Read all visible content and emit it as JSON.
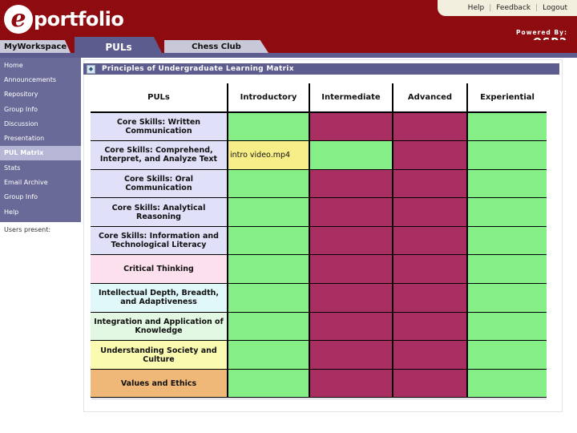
{
  "brand": {
    "logo_letter": "e",
    "logo_text": "portfolio",
    "powered_by": "Powered By:",
    "product": "OSP2",
    "header_color": "#8e0c10",
    "accent_color": "#5c5c8e"
  },
  "top_links": {
    "help": "Help",
    "feedback": "Feedback",
    "logout": "Logout"
  },
  "tabs": {
    "myworkspace": "MyWorkspace",
    "puls": "PULs",
    "chessclub": "Chess Club",
    "active": "PULs"
  },
  "sidebar": {
    "items": [
      {
        "label": "Home"
      },
      {
        "label": "Announcements"
      },
      {
        "label": "Repository"
      },
      {
        "label": "Group Info"
      },
      {
        "label": "Discussion"
      },
      {
        "label": "Presentation"
      },
      {
        "label": "PUL Matrix",
        "active": true
      },
      {
        "label": "Stats"
      },
      {
        "label": "Email Archive"
      },
      {
        "label": "Group Info"
      },
      {
        "label": "Help"
      }
    ],
    "users_present": "Users present:"
  },
  "panel": {
    "title": "Principles of Undergraduate Learning Matrix"
  },
  "matrix": {
    "columns": {
      "puls": "PULs",
      "introductory": "Introductory",
      "intermediate": "Intermediate",
      "advanced": "Advanced",
      "experiential": "Experiential"
    },
    "status_colors": {
      "green": "#86ee86",
      "maroon": "#a92e62",
      "yellow": "#f7ee88"
    },
    "rows": [
      {
        "label": "Core Skills: Written Communication",
        "color": "#e0e0f8",
        "cells": [
          {
            "status": "green"
          },
          {
            "status": "maroon"
          },
          {
            "status": "maroon"
          },
          {
            "status": "green"
          }
        ]
      },
      {
        "label": "Core Skills: Comprehend, Interpret, and Analyze Text",
        "color": "#e0e0f8",
        "cells": [
          {
            "status": "yellow",
            "text": "intro video.mp4"
          },
          {
            "status": "green"
          },
          {
            "status": "maroon"
          },
          {
            "status": "green"
          }
        ]
      },
      {
        "label": "Core Skills: Oral Communication",
        "color": "#e0e0f8",
        "cells": [
          {
            "status": "green"
          },
          {
            "status": "maroon"
          },
          {
            "status": "maroon"
          },
          {
            "status": "green"
          }
        ]
      },
      {
        "label": "Core Skills: Analytical Reasoning",
        "color": "#e0e0f8",
        "cells": [
          {
            "status": "green"
          },
          {
            "status": "maroon"
          },
          {
            "status": "maroon"
          },
          {
            "status": "green"
          }
        ]
      },
      {
        "label": "Core Skills: Information and Technological Literacy",
        "color": "#e0e0f8",
        "cells": [
          {
            "status": "green"
          },
          {
            "status": "maroon"
          },
          {
            "status": "maroon"
          },
          {
            "status": "green"
          }
        ]
      },
      {
        "label": "Critical Thinking",
        "color": "#fde0ee",
        "cells": [
          {
            "status": "green"
          },
          {
            "status": "maroon"
          },
          {
            "status": "maroon"
          },
          {
            "status": "green"
          }
        ]
      },
      {
        "label": "Intellectual Depth, Breadth, and Adaptiveness",
        "color": "#e0f8fa",
        "cells": [
          {
            "status": "green"
          },
          {
            "status": "maroon"
          },
          {
            "status": "maroon"
          },
          {
            "status": "green"
          }
        ]
      },
      {
        "label": "Integration and Application of Knowledge",
        "color": "#e2f8e2",
        "cells": [
          {
            "status": "green"
          },
          {
            "status": "maroon"
          },
          {
            "status": "maroon"
          },
          {
            "status": "green"
          }
        ]
      },
      {
        "label": "Understanding Society and Culture",
        "color": "#fafab0",
        "cells": [
          {
            "status": "green"
          },
          {
            "status": "maroon"
          },
          {
            "status": "maroon"
          },
          {
            "status": "green"
          }
        ]
      },
      {
        "label": "Values and Ethics",
        "color": "#f0b878",
        "cells": [
          {
            "status": "green"
          },
          {
            "status": "maroon"
          },
          {
            "status": "maroon"
          },
          {
            "status": "green"
          }
        ]
      }
    ]
  }
}
